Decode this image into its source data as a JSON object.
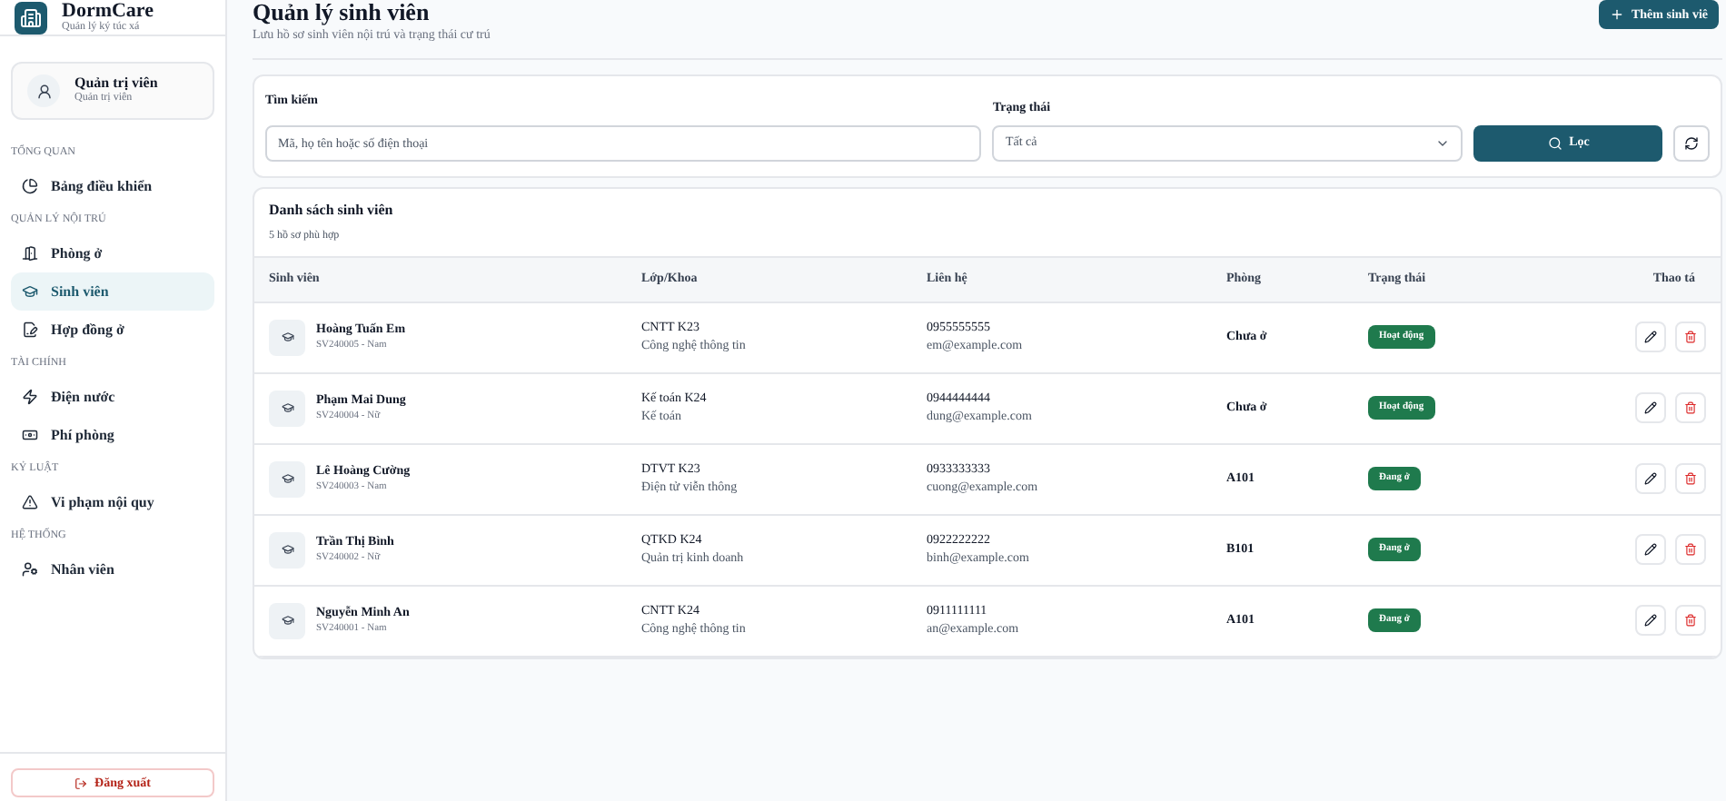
{
  "brand": {
    "name": "DormCare",
    "tagline": "Quản lý ký túc xá"
  },
  "user": {
    "name": "Quản trị viên",
    "role": "Quản trị viên"
  },
  "nav": [
    {
      "heading": "TỔNG QUAN",
      "items": [
        {
          "label": "Bảng điều khiển",
          "selected": false
        }
      ]
    },
    {
      "heading": "QUẢN LÝ NỘI TRÚ",
      "items": [
        {
          "label": "Phòng ở",
          "selected": false
        },
        {
          "label": "Sinh viên",
          "selected": true
        },
        {
          "label": "Hợp đồng ở",
          "selected": false
        }
      ]
    },
    {
      "heading": "TÀI CHÍNH",
      "items": [
        {
          "label": "Điện nước",
          "selected": false
        },
        {
          "label": "Phí phòng",
          "selected": false
        }
      ]
    },
    {
      "heading": "KỶ LUẬT",
      "items": [
        {
          "label": "Vi phạm nội quy",
          "selected": false
        }
      ]
    },
    {
      "heading": "HỆ THỐNG",
      "items": [
        {
          "label": "Nhân viên",
          "selected": false
        }
      ]
    }
  ],
  "logout": "Đăng xuất",
  "page": {
    "title": "Quản lý sinh viên",
    "subtitle": "Lưu hồ sơ sinh viên nội trú và trạng thái cư trú",
    "add_button": "Thêm sinh viê"
  },
  "filters": {
    "search_label": "Tìm kiếm",
    "search_placeholder": "Mã, họ tên hoặc số điện thoại",
    "status_label": "Trạng thái",
    "status_value": "Tất cả",
    "filter_button": "Lọc"
  },
  "table": {
    "title": "Danh sách sinh viên",
    "count": "5 hồ sơ phù hợp",
    "columns": [
      "Sinh viên",
      "Lớp/Khoa",
      "Liên hệ",
      "Phòng",
      "Trạng thái",
      "Thao tá"
    ],
    "rows": [
      {
        "name": "Hoàng Tuấn Em",
        "code": "SV240005 - Nam",
        "class": "CNTT K23",
        "faculty": "Công nghệ thông tin",
        "phone": "0955555555",
        "email": "em@example.com",
        "room": "Chưa ở",
        "status": "Hoạt động"
      },
      {
        "name": "Phạm Mai Dung",
        "code": "SV240004 - Nữ",
        "class": "Kế toán K24",
        "faculty": "Kế toán",
        "phone": "0944444444",
        "email": "dung@example.com",
        "room": "Chưa ở",
        "status": "Hoạt động"
      },
      {
        "name": "Lê Hoàng Cường",
        "code": "SV240003 - Nam",
        "class": "DTVT K23",
        "faculty": "Điện tử viễn thông",
        "phone": "0933333333",
        "email": "cuong@example.com",
        "room": "A101",
        "status": "Đang ở"
      },
      {
        "name": "Trần Thị Bình",
        "code": "SV240002 - Nữ",
        "class": "QTKD K24",
        "faculty": "Quản trị kinh doanh",
        "phone": "0922222222",
        "email": "binh@example.com",
        "room": "B101",
        "status": "Đang ở"
      },
      {
        "name": "Nguyễn Minh An",
        "code": "SV240001 - Nam",
        "class": "CNTT K24",
        "faculty": "Công nghệ thông tin",
        "phone": "0911111111",
        "email": "an@example.com",
        "room": "A101",
        "status": "Đang ở"
      }
    ]
  }
}
